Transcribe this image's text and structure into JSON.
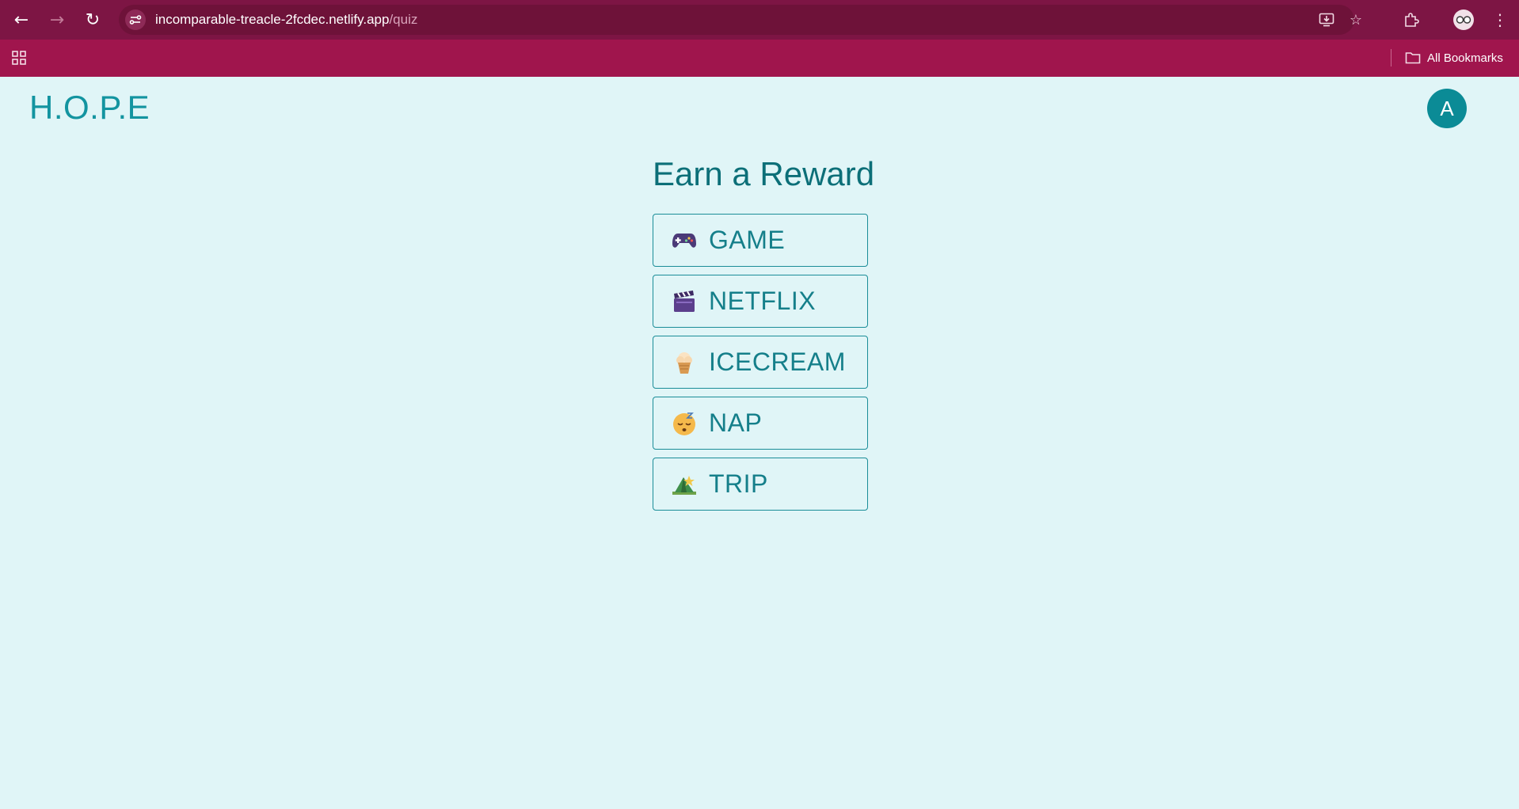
{
  "browser": {
    "url_host": "incomparable-treacle-2fcdec.netlify.app",
    "url_path": "/quiz",
    "bookmarks_label": "All Bookmarks",
    "icons": {
      "back": "←",
      "forward": "→",
      "reload": "↻",
      "bookmark_star": "☆",
      "menu": "⋮"
    }
  },
  "header": {
    "logo": "H.O.P.E",
    "avatar_initial": "A"
  },
  "main": {
    "title": "Earn a Reward",
    "rewards": [
      {
        "label": "GAME",
        "icon": "game-controller-icon"
      },
      {
        "label": "NETFLIX",
        "icon": "clapper-board-icon"
      },
      {
        "label": "ICECREAM",
        "icon": "ice-cream-icon"
      },
      {
        "label": "NAP",
        "icon": "sleeping-face-icon"
      },
      {
        "label": "TRIP",
        "icon": "camping-tent-icon"
      }
    ]
  },
  "colors": {
    "chrome_bar": "#a0154d",
    "toolbar": "#7d1544",
    "page_background": "#e0f5f7",
    "accent": "#1394a0",
    "heading": "#0c6f78",
    "avatar": "#0b8b96"
  }
}
